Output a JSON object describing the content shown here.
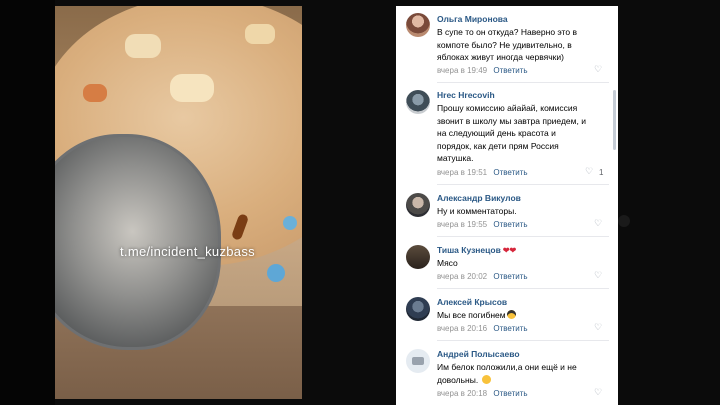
{
  "photo": {
    "watermark": "t.me/incident_kuzbass"
  },
  "comments": [
    {
      "author": "Ольга Миронова",
      "lines": [
        "В супе то он откуда? Наверно это в",
        "компоте было? Не удивительно, в",
        "яблоках живут иногда червячки)"
      ],
      "time": "вчера в 19:49",
      "reply": "Ответить",
      "likes": ""
    },
    {
      "author": "Hrec Hrecovih",
      "lines": [
        "Прошу комиссию айайай, комиссия",
        "звонит в школу мы завтра приедем, и",
        "на следующий день красота и",
        "порядок, как дети прям Россия",
        "матушка."
      ],
      "time": "вчера в 19:51",
      "reply": "Ответить",
      "likes": "1"
    },
    {
      "author": "Александр Викулов",
      "lines": [
        "Ну и комментаторы."
      ],
      "time": "вчера в 19:55",
      "reply": "Ответить",
      "likes": ""
    },
    {
      "author": "Тиша Кузнецов",
      "lines": [
        "Мясо"
      ],
      "time": "вчера в 20:02",
      "reply": "Ответить",
      "likes": ""
    },
    {
      "author": "Алексей Крысов",
      "lines": [
        "Мы все погибнем"
      ],
      "time": "вчера в 20:16",
      "reply": "Ответить",
      "likes": ""
    },
    {
      "author": "Андрей Полысаево",
      "lines": [
        "Им белок положили,а они ещё и не",
        "довольны."
      ],
      "time": "вчера в 20:18",
      "reply": "Ответить",
      "likes": ""
    }
  ],
  "colors": {
    "link": "#2a5885",
    "meta": "#939393"
  }
}
